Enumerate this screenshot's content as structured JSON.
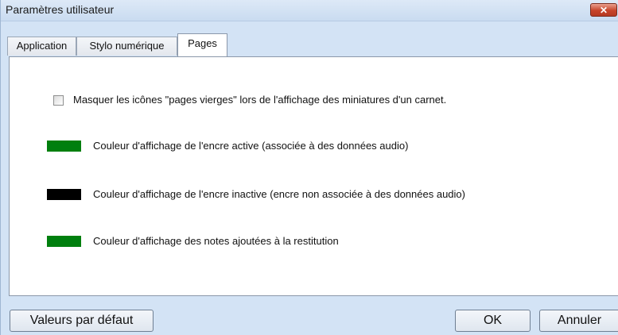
{
  "window": {
    "title": "Paramètres utilisateur",
    "close_label": "✕"
  },
  "tabs": [
    {
      "label": "Application",
      "active": false
    },
    {
      "label": "Stylo numérique",
      "active": false
    },
    {
      "label": "Pages",
      "active": true
    }
  ],
  "pages": {
    "hide_blank_pages": {
      "label": "Masquer les icônes \"pages vierges\" lors de l'affichage des miniatures d'un carnet.",
      "checked": false
    },
    "colors": [
      {
        "label": "Couleur d'affichage de l'encre active (associée à des données audio)",
        "color": "#007f0e"
      },
      {
        "label": "Couleur d'affichage de l'encre inactive (encre non associée à des données audio)",
        "color": "#000000"
      },
      {
        "label": "Couleur d'affichage des notes ajoutées à la restitution",
        "color": "#007f0e"
      }
    ]
  },
  "footer": {
    "defaults_label": "Valeurs par défaut",
    "ok_label": "OK",
    "cancel_label": "Annuler"
  }
}
